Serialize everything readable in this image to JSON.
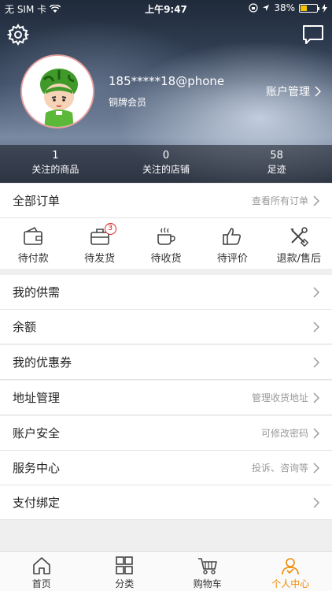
{
  "status_bar": {
    "carrier": "无 SIM 卡",
    "time": "上午9:47",
    "battery": "38%",
    "battery_level": 0.38
  },
  "profile": {
    "username": "185*****18@phone",
    "level": "铜牌会员",
    "account_mgmt": "账户管理"
  },
  "stats": [
    {
      "num": "1",
      "label": "关注的商品"
    },
    {
      "num": "0",
      "label": "关注的店铺"
    },
    {
      "num": "58",
      "label": "足迹"
    }
  ],
  "orders": {
    "title": "全部订单",
    "hint": "查看所有订单",
    "items": [
      {
        "label": "待付款",
        "icon": "wallet-icon"
      },
      {
        "label": "待发货",
        "icon": "briefcase-icon",
        "badge": "3"
      },
      {
        "label": "待收货",
        "icon": "coffee-cup-icon"
      },
      {
        "label": "待评价",
        "icon": "thumbs-up-icon"
      },
      {
        "label": "退款/售后",
        "icon": "tools-icon"
      }
    ]
  },
  "menu": [
    {
      "label": "我的供需",
      "hint": ""
    },
    {
      "label": "余额",
      "hint": ""
    },
    {
      "label": "我的优惠券",
      "hint": ""
    },
    {
      "label": "地址管理",
      "hint": "管理收货地址"
    },
    {
      "label": "账户安全",
      "hint": "可修改密码"
    },
    {
      "label": "服务中心",
      "hint": "投诉、咨询等"
    },
    {
      "label": "支付绑定",
      "hint": ""
    }
  ],
  "tabbar": [
    {
      "label": "首页",
      "icon": "home-icon"
    },
    {
      "label": "分类",
      "icon": "grid-icon"
    },
    {
      "label": "购物车",
      "icon": "cart-icon"
    },
    {
      "label": "个人中心",
      "icon": "person-icon",
      "active": true
    }
  ],
  "colors": {
    "accent": "#f08a00",
    "badge": "#e02020"
  }
}
